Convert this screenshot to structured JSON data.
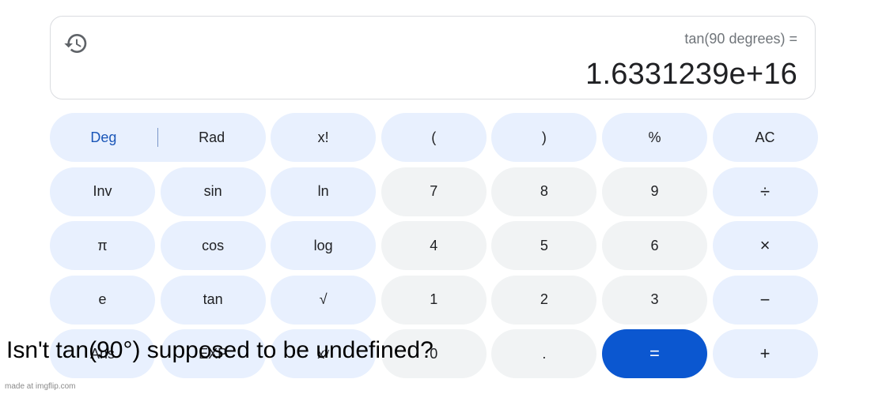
{
  "display": {
    "history_icon": "history-icon",
    "expression": "tan(90 degrees) =",
    "result": "1.6331239e+16"
  },
  "mode": {
    "deg_label": "Deg",
    "rad_label": "Rad",
    "selected": "Deg"
  },
  "keys": {
    "factorial": "x!",
    "open_paren": "(",
    "close_paren": ")",
    "percent": "%",
    "clear": "AC",
    "inv": "Inv",
    "sin": "sin",
    "ln": "ln",
    "seven": "7",
    "eight": "8",
    "nine": "9",
    "divide": "÷",
    "pi": "π",
    "cos": "cos",
    "log": "log",
    "four": "4",
    "five": "5",
    "six": "6",
    "multiply": "×",
    "e": "e",
    "tan": "tan",
    "sqrt": "√",
    "one": "1",
    "two": "2",
    "three": "3",
    "minus": "−",
    "ans": "Ans",
    "exp": "EXP",
    "power": "xʸ",
    "zero": "0",
    "decimal": ".",
    "equals": "=",
    "plus": "+"
  },
  "colors": {
    "function_key": "#e8f0fe",
    "number_key": "#f1f3f4",
    "equals_key": "#0b57d0",
    "selected_mode": "#1a56b8"
  },
  "caption": "Isn't tan(90°) supposed to be undefined?",
  "watermark": "made at imgflip.com"
}
